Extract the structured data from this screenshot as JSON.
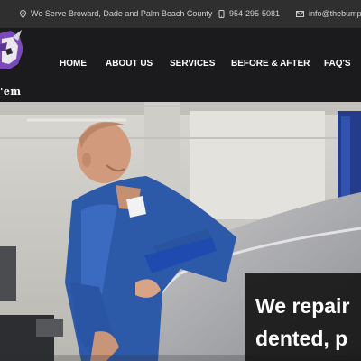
{
  "topbar": {
    "location": "We Serve Broward, Dade and Palm Beach County",
    "phone": "954-295-5081",
    "email": "info@thebump"
  },
  "logo": {
    "text": "'em"
  },
  "nav": {
    "items": [
      "HOME",
      "ABOUT US",
      "SERVICES",
      "BEFORE & AFTER",
      "FAQ'S"
    ],
    "active": "HOME"
  },
  "hero": {
    "line1": "We repair",
    "line2": "dented, p"
  },
  "colors": {
    "accent": "#7b4fd1",
    "topbar": "#2f2f2f",
    "header": "#1b1b1d"
  }
}
